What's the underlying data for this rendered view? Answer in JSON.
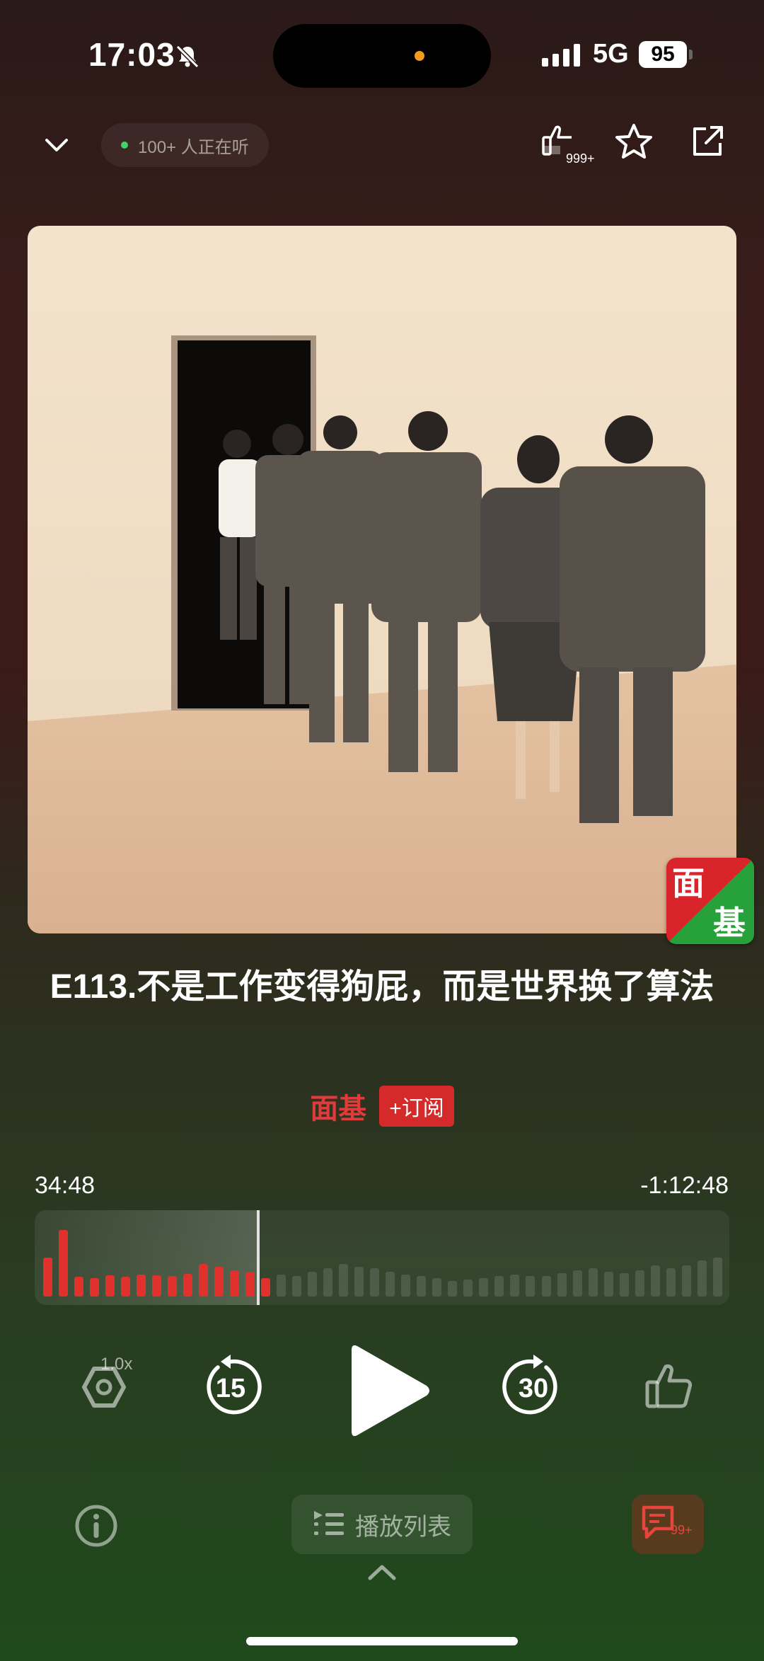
{
  "status": {
    "time": "17:03",
    "network": "5G",
    "battery": "95"
  },
  "header": {
    "listeners_text": "100+ 人正在听",
    "likes_badge": "999+"
  },
  "episode": {
    "title": "E113.不是工作变得狗屁，而是世界换了算法",
    "author": "面基",
    "subscribe_label": "+订阅",
    "logo_chars": [
      "面",
      "基"
    ]
  },
  "player": {
    "elapsed": "34:48",
    "remaining": "-1:12:48",
    "progress": 0.32,
    "speed": "1.0x",
    "rewind_seconds": "15",
    "forward_seconds": "30",
    "played_color": "#e0312c",
    "unplayed_color": "rgba(255,255,255,0.12)"
  },
  "bottom_bar": {
    "playlist_label": "播放列表",
    "comments_badge": "99+"
  },
  "icons": {
    "collapse": "chevron-down-icon",
    "likes": "like-count-icon",
    "favorite": "star-icon",
    "share": "share-icon",
    "speed": "speed-icon",
    "rewind": "rewind-15-icon",
    "play": "play-icon",
    "forward": "forward-30-icon",
    "like": "thumbs-up-icon",
    "info": "info-icon",
    "playlist": "playlist-icon",
    "comments": "comments-icon"
  },
  "waveform": [
    0.5,
    0.85,
    0.25,
    0.24,
    0.27,
    0.25,
    0.28,
    0.27,
    0.26,
    0.29,
    0.42,
    0.38,
    0.34,
    0.32,
    0.24,
    0.28,
    0.26,
    0.32,
    0.36,
    0.42,
    0.38,
    0.36,
    0.32,
    0.28,
    0.26,
    0.24,
    0.2,
    0.22,
    0.24,
    0.26,
    0.28,
    0.26,
    0.26,
    0.3,
    0.34,
    0.36,
    0.32,
    0.3,
    0.34,
    0.4,
    0.36,
    0.4,
    0.46,
    0.5
  ]
}
